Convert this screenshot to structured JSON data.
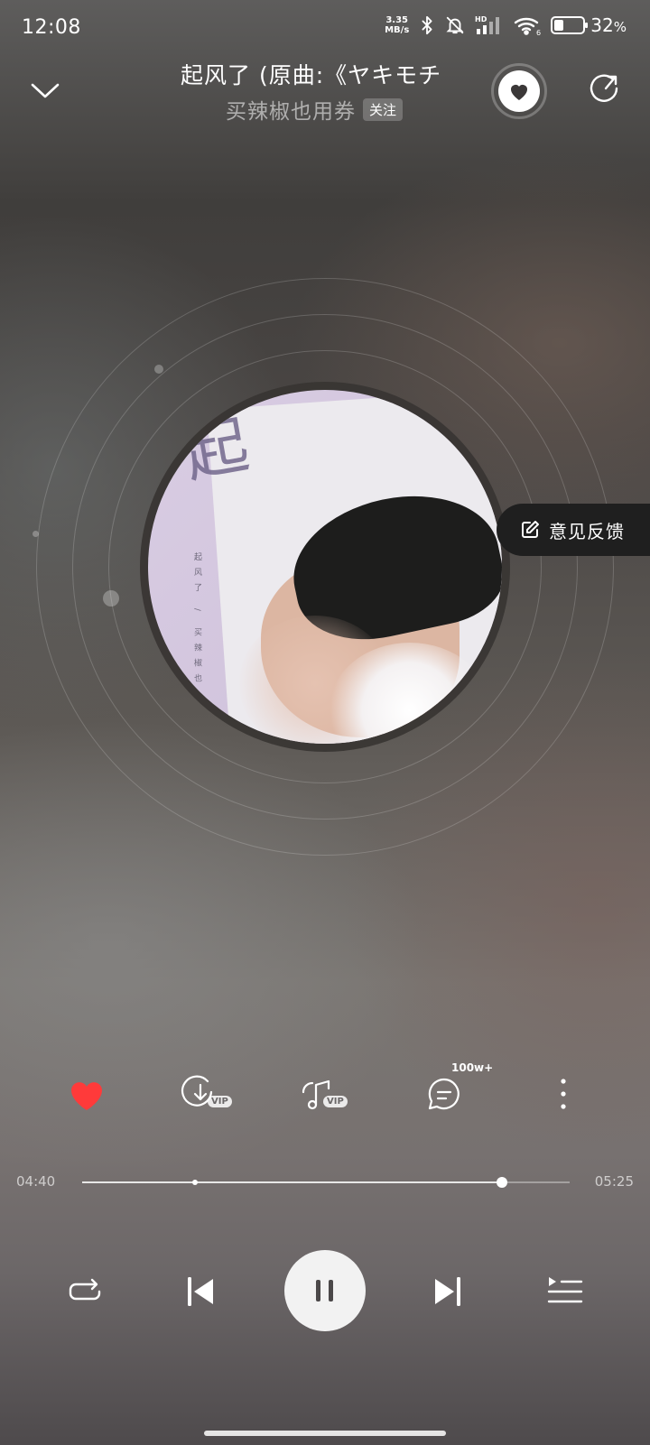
{
  "status_bar": {
    "time": "12:08",
    "net_speed_value": "3.35",
    "net_speed_unit": "MB/s",
    "hd_label": "HD",
    "signal_label": "6",
    "battery_percent": "32",
    "battery_symbol": "%",
    "battery_level": 0.32
  },
  "header": {
    "song_title": "起风了 (原曲:《ヤキモチ",
    "artist": "买辣椒也用券",
    "follow_label": "关注"
  },
  "album_art": {
    "glyph": "起",
    "vertical_text": "起风了 / 买辣椒也"
  },
  "feedback": {
    "label": "意见反馈"
  },
  "actions": {
    "vip_label": "VIP",
    "comment_count": "100w+"
  },
  "progress": {
    "current_time": "04:40",
    "total_time": "05:25",
    "played_fraction": 0.862,
    "marker_fraction": 0.232
  },
  "colors": {
    "like_red": "#ff3a3a",
    "accent_white": "#ffffff"
  },
  "icons": {
    "collapse": "chevron-down-icon",
    "favorite": "heart-icon",
    "share": "share-icon",
    "download": "download-icon",
    "ringtone": "music-note-icon",
    "comment": "comment-icon",
    "more": "more-vertical-icon",
    "repeat": "repeat-icon",
    "previous": "skip-previous-icon",
    "pause": "pause-icon",
    "next": "skip-next-icon",
    "playlist": "playlist-icon",
    "feedback": "edit-icon"
  }
}
